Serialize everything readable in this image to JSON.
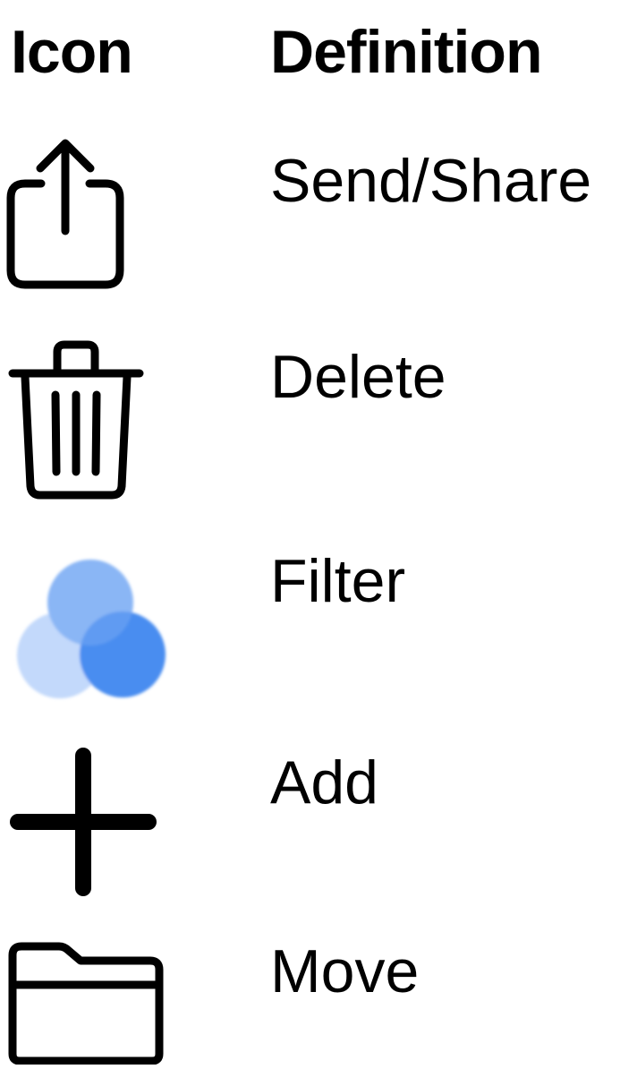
{
  "header": {
    "icon_col": "Icon",
    "definition_col": "Definition"
  },
  "rows": [
    {
      "icon": "share-icon",
      "label": "Send/Share"
    },
    {
      "icon": "trash-icon",
      "label": "Delete"
    },
    {
      "icon": "filter-icon",
      "label": "Filter"
    },
    {
      "icon": "plus-icon",
      "label": "Add"
    },
    {
      "icon": "folder-icon",
      "label": "Move"
    }
  ],
  "colors": {
    "text": "#000000",
    "filter_light": "#c3d9fb",
    "filter_mid": "#8ab6f5",
    "filter_dark": "#4a8df0"
  }
}
